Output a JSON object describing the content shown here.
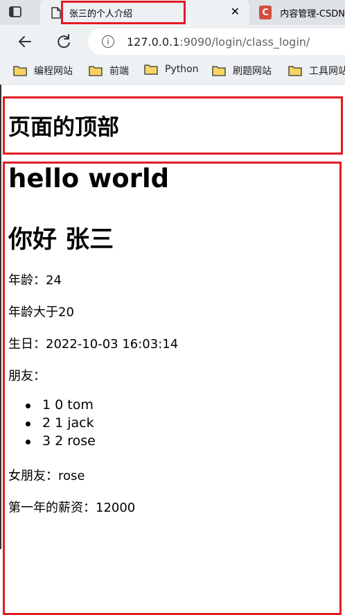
{
  "browser": {
    "active_tab": {
      "title": "张三的个人介绍"
    },
    "inactive_tab": {
      "title": "内容管理-CSDN",
      "icon_letter": "C"
    },
    "close_glyph": "✕",
    "url_host": "127.0.0.1",
    "url_rest": ":9090/login/class_login/",
    "bookmarks": [
      {
        "label": "编程网站"
      },
      {
        "label": "前端"
      },
      {
        "label": "Python"
      },
      {
        "label": "刷题网站"
      },
      {
        "label": "工具网站"
      }
    ],
    "accent_annotation_color": "#e21b23"
  },
  "page": {
    "header": "页面的顶部",
    "hello": "hello world",
    "greeting": "你好 张三",
    "age": "年龄：24",
    "age_check": "年龄大于20",
    "birthday": "生日：2022-10-03 16:03:14",
    "friends_label": "朋友：",
    "friends": [
      {
        "text": "1 0 tom"
      },
      {
        "text": "2 1 jack"
      },
      {
        "text": "3 2 rose"
      }
    ],
    "girlfriend": "女朋友：rose",
    "first_year_salary": "第一年的薪资：12000"
  }
}
